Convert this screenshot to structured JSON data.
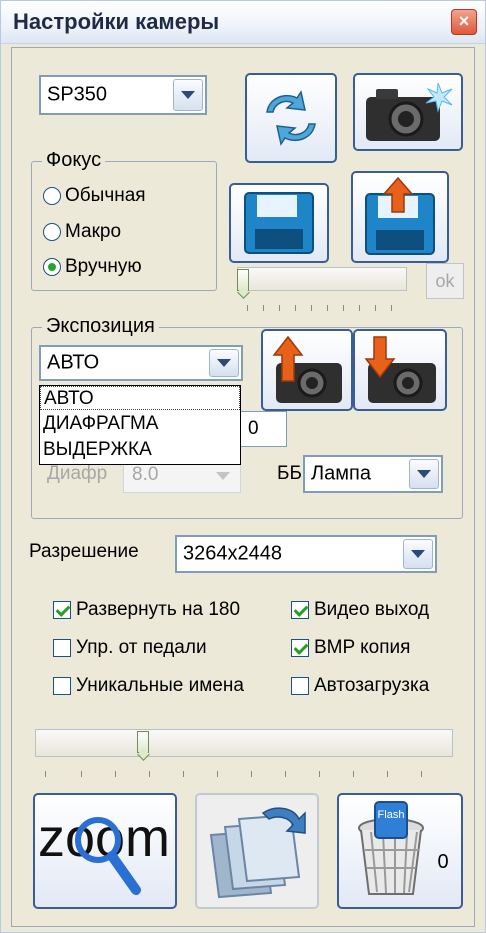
{
  "window": {
    "title": "Настройки камеры",
    "close_label": "×"
  },
  "camera_model": {
    "value": "SP350"
  },
  "focus": {
    "legend": "Фокус",
    "options": [
      {
        "label": "Обычная",
        "selected": false
      },
      {
        "label": "Макро",
        "selected": false
      },
      {
        "label": "Вручную",
        "selected": true
      }
    ]
  },
  "focus_ok_label": "ok",
  "exposure": {
    "legend": "Экспозиция",
    "mode_value": "АВТО",
    "dropdown_options": [
      "АВТО",
      "ДИАФРАГМА",
      "ВЫДЕРЖКА"
    ],
    "hidden_field_fragment": "0",
    "aperture_label": "Диафр",
    "aperture_value": "8.0",
    "wb_label": "ББ",
    "wb_value": "Лампа"
  },
  "resolution": {
    "label": "Разрешение",
    "value": "3264x2448"
  },
  "options": [
    {
      "label": "Развернуть на 180",
      "checked": true
    },
    {
      "label": "Видео выход",
      "checked": true
    },
    {
      "label": "Упр. от педали",
      "checked": false
    },
    {
      "label": "BMP копия",
      "checked": true
    },
    {
      "label": "Уникальные имена",
      "checked": false
    },
    {
      "label": "Автозагрузка",
      "checked": false
    }
  ],
  "zoom_button_label": "zoom",
  "trash": {
    "badge": "Flash",
    "count": "0"
  },
  "colors": {
    "button_border": "#3a5d95",
    "check_green": "#21a121",
    "camera_dark": "#2b2b2b",
    "arrow_orange": "#e8611a"
  }
}
